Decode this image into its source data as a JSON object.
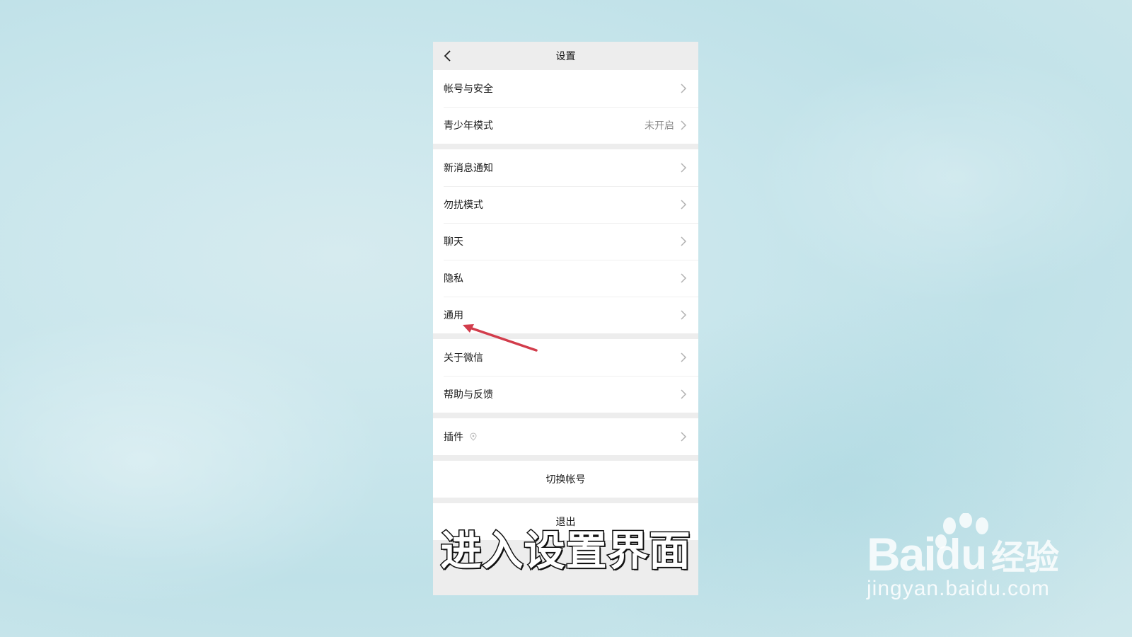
{
  "header": {
    "title": "设置"
  },
  "groups": [
    {
      "items": [
        {
          "label": "帐号与安全"
        },
        {
          "label": "青少年模式",
          "value": "未开启"
        }
      ]
    },
    {
      "items": [
        {
          "label": "新消息通知"
        },
        {
          "label": "勿扰模式"
        },
        {
          "label": "聊天"
        },
        {
          "label": "隐私"
        },
        {
          "label": "通用"
        }
      ]
    },
    {
      "items": [
        {
          "label": "关于微信"
        },
        {
          "label": "帮助与反馈"
        }
      ]
    },
    {
      "items": [
        {
          "label": "插件",
          "icon": "plugin-badge-icon"
        }
      ]
    }
  ],
  "actions": {
    "switch_account": "切换帐号",
    "logout": "退出"
  },
  "caption": "进入设置界面",
  "annotation": {
    "icon": "red-arrow-icon",
    "color": "#d23c4b"
  },
  "watermark": {
    "brand": "Baidu",
    "brand_bai": "Bai",
    "brand_du": "du",
    "product": "经验",
    "url": "jingyan.baidu.com"
  }
}
